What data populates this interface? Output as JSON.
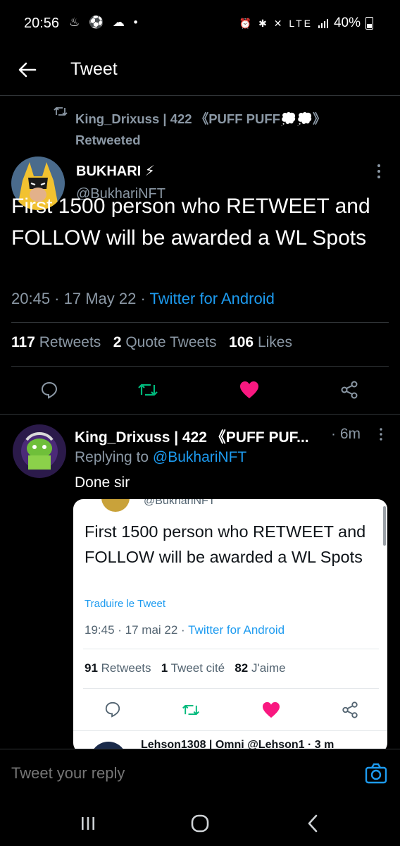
{
  "status_bar": {
    "time": "20:56",
    "left_icons": "♨ ⚽ ☁ •",
    "right_icons": "⏰ ✱ ✕ LTE",
    "battery": "40%"
  },
  "header": {
    "title": "Tweet"
  },
  "retweet_context": {
    "line": "King_Drixuss | 422 《PUFF PUFF💭💭》",
    "suffix": "Retweeted"
  },
  "main_tweet": {
    "name": "BUKHARI ⚡",
    "handle": "@BukhariNFT",
    "text": "First 1500 person who RETWEET and FOLLOW will be awarded a WL Spots",
    "time": "20:45 · 17 May 22 · ",
    "source": "Twitter for Android",
    "retweets_count": "117",
    "retweets_label": "Retweets",
    "quotes_count": "2",
    "quotes_label": "Quote Tweets",
    "likes_count": "106",
    "likes_label": "Likes"
  },
  "reply": {
    "name": "King_Drixuss | 422 《PUFF PUF...",
    "time": "· 6m",
    "replying_prefix": "Replying to ",
    "replying_handle": "@BukhariNFT",
    "text": "Done sir"
  },
  "embedded_card": {
    "handle_partial": "@BukhariNFT",
    "text": "First 1500 person who RETWEET and FOLLOW will be awarded a WL Spots",
    "translate": "Traduire le Tweet",
    "time": "19:45 · 17 mai 22 · ",
    "source": "Twitter for Android",
    "retweets_count": "91",
    "retweets_label": "Retweets",
    "quotes_count": "1",
    "quotes_label": "Tweet cité",
    "likes_count": "82",
    "likes_label": "J'aime",
    "next_line": "Lehson1308 | Omni @Lehson1 · 3 m"
  },
  "reply_box": {
    "placeholder": "Tweet your reply"
  },
  "colors": {
    "accent": "#1d9bf0",
    "like": "#f91880",
    "retweet": "#00ba7c"
  }
}
